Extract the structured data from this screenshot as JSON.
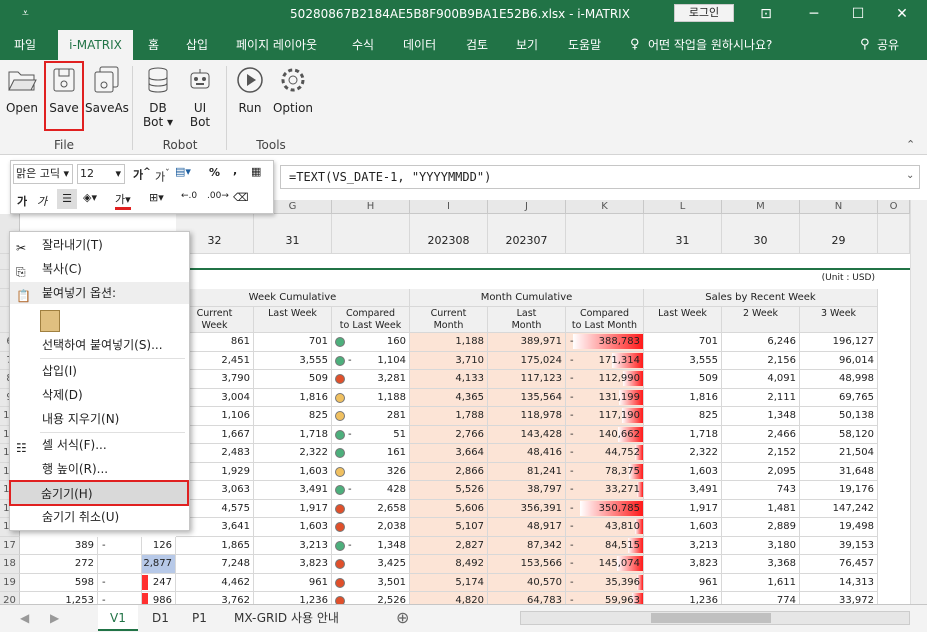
{
  "window": {
    "title": "50280867B2184AE5B8F900B9BA1E52B6.xlsx - i-MATRIX",
    "login_label": "로그인",
    "quick_access_icon": "quick-access-icon"
  },
  "ribbon_tabs": [
    "파일",
    "i-MATRIX",
    "홈",
    "삽입",
    "페이지 레이아웃",
    "수식",
    "데이터",
    "검토",
    "보기",
    "도움말",
    "어떤 작업을 원하시나요?"
  ],
  "share_label": "공유",
  "ribbon": {
    "buttons": [
      {
        "label": "Open"
      },
      {
        "label": "Save"
      },
      {
        "label": "SaveAs"
      },
      {
        "label": "DB\nBot"
      },
      {
        "label": "UI\nBot"
      },
      {
        "label": "Run"
      },
      {
        "label": "Option"
      }
    ],
    "groups": [
      "File",
      "Robot",
      "Tools"
    ]
  },
  "formula_bar": {
    "formula": "=TEXT(VS_DATE-1, \"YYYYMMDD\")"
  },
  "mini_toolbar": {
    "font": "맑은 고딕",
    "size": "12"
  },
  "columns": [
    "G",
    "H",
    "I",
    "J",
    "K",
    "L",
    "M",
    "N",
    "O"
  ],
  "header_row": {
    "G": "32",
    "G2": "31",
    "I": "202308",
    "J": "202307",
    "L": "31",
    "M": "30",
    "N": "29"
  },
  "unit_label": "(Unit : USD)",
  "group_headers": [
    "Week Cumulative",
    "Month Cumulative",
    "Sales by Recent Week"
  ],
  "sub_headers": [
    "Current\nWeek",
    "Last Week",
    "Compared\nto Last Week",
    "Current\nMonth",
    "Last\nMonth",
    "Compared\nto Last Month",
    "Last Week",
    "2 Week",
    "3 Week"
  ],
  "rows": [
    {
      "r": "6",
      "cw": "861",
      "lw": "701",
      "dot": "green",
      "cmp": "160",
      "cm": "1,188",
      "lm": "389,971",
      "cmpm": "388,783",
      "bar": 1.0,
      "l1": "701",
      "l2": "6,246",
      "l3": "196,127"
    },
    {
      "r": "7",
      "cw": "2,451",
      "lw": "3,555",
      "dot": "green",
      "dash": "1",
      "cmp": "1,104",
      "cm": "3,710",
      "lm": "175,024",
      "cmpm": "171,314",
      "bar": 0.44,
      "l1": "3,555",
      "l2": "2,156",
      "l3": "96,014"
    },
    {
      "r": "8",
      "cw": "3,790",
      "lw": "509",
      "dot": "red",
      "cmp": "3,281",
      "cm": "4,133",
      "lm": "117,123",
      "cmpm": "112,990",
      "bar": 0.29,
      "l1": "509",
      "l2": "4,091",
      "l3": "48,998"
    },
    {
      "r": "9",
      "cw": "3,004",
      "lw": "1,816",
      "dot": "yellow",
      "cmp": "1,188",
      "cm": "4,365",
      "lm": "135,564",
      "cmpm": "131,199",
      "bar": 0.34,
      "l1": "1,816",
      "l2": "2,111",
      "l3": "69,765"
    },
    {
      "r": "10",
      "cw": "1,106",
      "lw": "825",
      "dot": "yellow",
      "cmp": "281",
      "cm": "1,788",
      "lm": "118,978",
      "cmpm": "117,190",
      "bar": 0.3,
      "l1": "825",
      "l2": "1,348",
      "l3": "50,138"
    },
    {
      "r": "11",
      "cw": "1,667",
      "lw": "1,718",
      "dot": "green",
      "dash": "1",
      "cmp": "51",
      "cm": "2,766",
      "lm": "143,428",
      "cmpm": "140,662",
      "bar": 0.36,
      "l1": "1,718",
      "l2": "2,466",
      "l3": "58,120"
    },
    {
      "r": "12",
      "cw": "2,483",
      "lw": "2,322",
      "dot": "green",
      "cmp": "161",
      "cm": "3,664",
      "lm": "48,416",
      "cmpm": "44,752",
      "bar": 0.12,
      "l1": "2,322",
      "l2": "2,152",
      "l3": "21,504"
    },
    {
      "r": "13",
      "cw": "1,929",
      "lw": "1,603",
      "dot": "yellow",
      "cmp": "326",
      "cm": "2,866",
      "lm": "81,241",
      "cmpm": "78,375",
      "bar": 0.2,
      "l1": "1,603",
      "l2": "2,095",
      "l3": "31,648"
    },
    {
      "r": "14",
      "cw": "3,063",
      "lw": "3,491",
      "dot": "green",
      "dash": "1",
      "cmp": "428",
      "cm": "5,526",
      "lm": "38,797",
      "cmpm": "33,271",
      "bar": 0.09,
      "l1": "3,491",
      "l2": "743",
      "l3": "19,176"
    },
    {
      "r": "15",
      "cw": "4,575",
      "lw": "1,917",
      "dot": "red",
      "cmp": "2,658",
      "cm": "5,606",
      "lm": "356,391",
      "cmpm": "350,785",
      "bar": 0.9,
      "l1": "1,917",
      "l2": "1,481",
      "l3": "147,242"
    },
    {
      "r": "16",
      "cw": "3,641",
      "lw": "1,603",
      "dot": "red",
      "cmp": "2,038",
      "cm": "5,107",
      "lm": "48,917",
      "cmpm": "43,810",
      "bar": 0.11,
      "l1": "1,603",
      "l2": "2,889",
      "l3": "19,498"
    },
    {
      "r": "17",
      "b": "389",
      "bd": "-",
      "c": "126",
      "cw": "1,865",
      "lw": "3,213",
      "dot": "green",
      "dash": "1",
      "cmp": "1,348",
      "cm": "2,827",
      "lm": "87,342",
      "cmpm": "84,515",
      "bar": 0.22,
      "l1": "3,213",
      "l2": "3,180",
      "l3": "39,153"
    },
    {
      "r": "18",
      "b": "272",
      "bd": "",
      "c": "2,877",
      "cw": "7,248",
      "lw": "3,823",
      "dot": "red",
      "cmp": "3,425",
      "cm": "8,492",
      "lm": "153,566",
      "cmpm": "145,074",
      "bar": 0.37,
      "l1": "3,823",
      "l2": "3,368",
      "l3": "76,457"
    },
    {
      "r": "19",
      "b": "598",
      "bd": "-",
      "c": "247",
      "cw": "4,462",
      "lw": "961",
      "dot": "red",
      "cmp": "3,501",
      "cm": "5,174",
      "lm": "40,570",
      "cmpm": "35,396",
      "bar": 0.09,
      "l1": "961",
      "l2": "1,611",
      "l3": "14,313"
    },
    {
      "r": "20",
      "b": "1,253",
      "bd": "-",
      "c": "986",
      "cw": "3,762",
      "lw": "1,236",
      "dot": "red",
      "cmp": "2,526",
      "cm": "4,820",
      "lm": "64,783",
      "cmpm": "59,963",
      "bar": 0.15,
      "l1": "1,236",
      "l2": "774",
      "l3": "33,972"
    }
  ],
  "context_menu": {
    "items": [
      {
        "label": "잘라내기(T)",
        "icon": "scissors-icon"
      },
      {
        "label": "복사(C)",
        "icon": "copy-icon"
      },
      {
        "label": "붙여넣기 옵션:",
        "icon": "paste-icon"
      },
      {
        "label": "",
        "icon": "clipboard-icon"
      },
      {
        "label": "선택하여 붙여넣기(S)...",
        "icon": ""
      },
      {
        "label": "삽입(I)",
        "icon": ""
      },
      {
        "label": "삭제(D)",
        "icon": ""
      },
      {
        "label": "내용 지우기(N)",
        "icon": ""
      },
      {
        "label": "셀 서식(F)...",
        "icon": "format-cells-icon"
      },
      {
        "label": "행 높이(R)...",
        "icon": ""
      },
      {
        "label": "숨기기(H)",
        "icon": ""
      },
      {
        "label": "숨기기 취소(U)",
        "icon": ""
      }
    ]
  },
  "sheet_tabs": [
    "V1",
    "D1",
    "P1",
    "MX-GRID 사용 안내"
  ],
  "colors": {
    "excel_green": "#217346",
    "peach": "#fce4d6",
    "dot_green": "#4daf7c",
    "dot_red": "#e0502b",
    "dot_yellow": "#f0c060"
  }
}
